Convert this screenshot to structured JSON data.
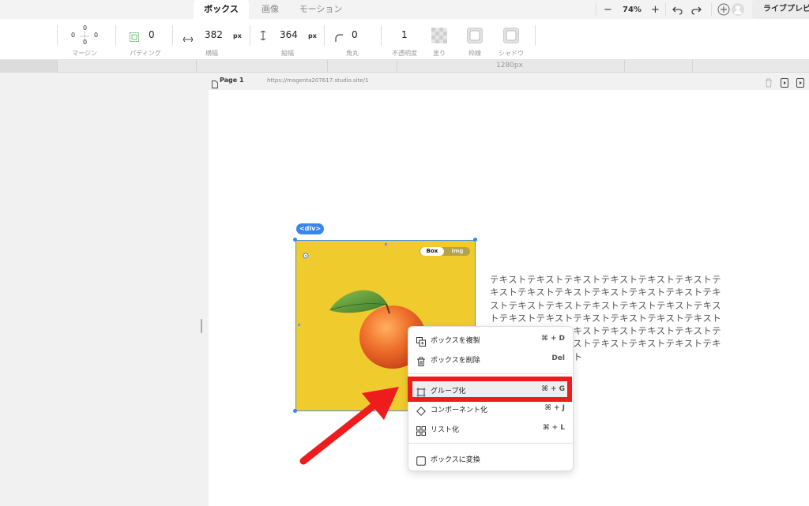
{
  "tabs": [
    {
      "label": "ボックス",
      "active": true
    },
    {
      "label": "画像",
      "active": false
    },
    {
      "label": "モーション",
      "active": false
    }
  ],
  "zoom": {
    "minus": "−",
    "value": "74%",
    "plus": "+"
  },
  "live_preview_label": "ライブプレビ",
  "props": {
    "margin": {
      "top": "0",
      "left": "0",
      "right": "0",
      "bottom": "0",
      "label": "マージン"
    },
    "padding": {
      "value": "0",
      "label": "パディング"
    },
    "width": {
      "value": "382",
      "unit": "px",
      "label": "横幅"
    },
    "height": {
      "value": "364",
      "unit": "px",
      "label": "縦幅"
    },
    "radius": {
      "value": "0",
      "label": "角丸"
    },
    "opacity": {
      "value": "1",
      "label": "不透明度"
    },
    "fill": {
      "label": "塗り"
    },
    "border": {
      "label": "枠線"
    },
    "shadow": {
      "label": "シャドウ"
    }
  },
  "ruler_label": "1280px",
  "page": {
    "name": "Page 1",
    "url": "https://magenta207617.studio.site/1"
  },
  "element_tag": "<div>",
  "box_toggle": {
    "on": "Box",
    "off": "Img"
  },
  "body_text": "テキストテキストテキストテキストテキストテキストテキストテキストテキストテキストテキストテキストテキストテキストテキストテキストテキストテキストテキストテキストテキストテキストテキストテキストテキストテキストテキストテキストテキストテキストテキストテキストテキストテキストテキストテキストテキストテキストテキストテキスト",
  "context_menu": {
    "items": [
      {
        "label": "ボックスを複製",
        "shortcut": "⌘ + D"
      },
      {
        "label": "ボックスを削除",
        "shortcut": "Del"
      },
      {
        "label": "グループ化",
        "shortcut": "⌘ + G"
      },
      {
        "label": "コンポーネント化",
        "shortcut": "⌘ + J"
      },
      {
        "label": "リスト化",
        "shortcut": "⌘ + L"
      },
      {
        "label": "ボックスに変換",
        "shortcut": ""
      }
    ]
  },
  "colors": {
    "accent": "#3a86f0",
    "box_fill": "#efcb2e",
    "highlight": "#ee1d1d"
  }
}
